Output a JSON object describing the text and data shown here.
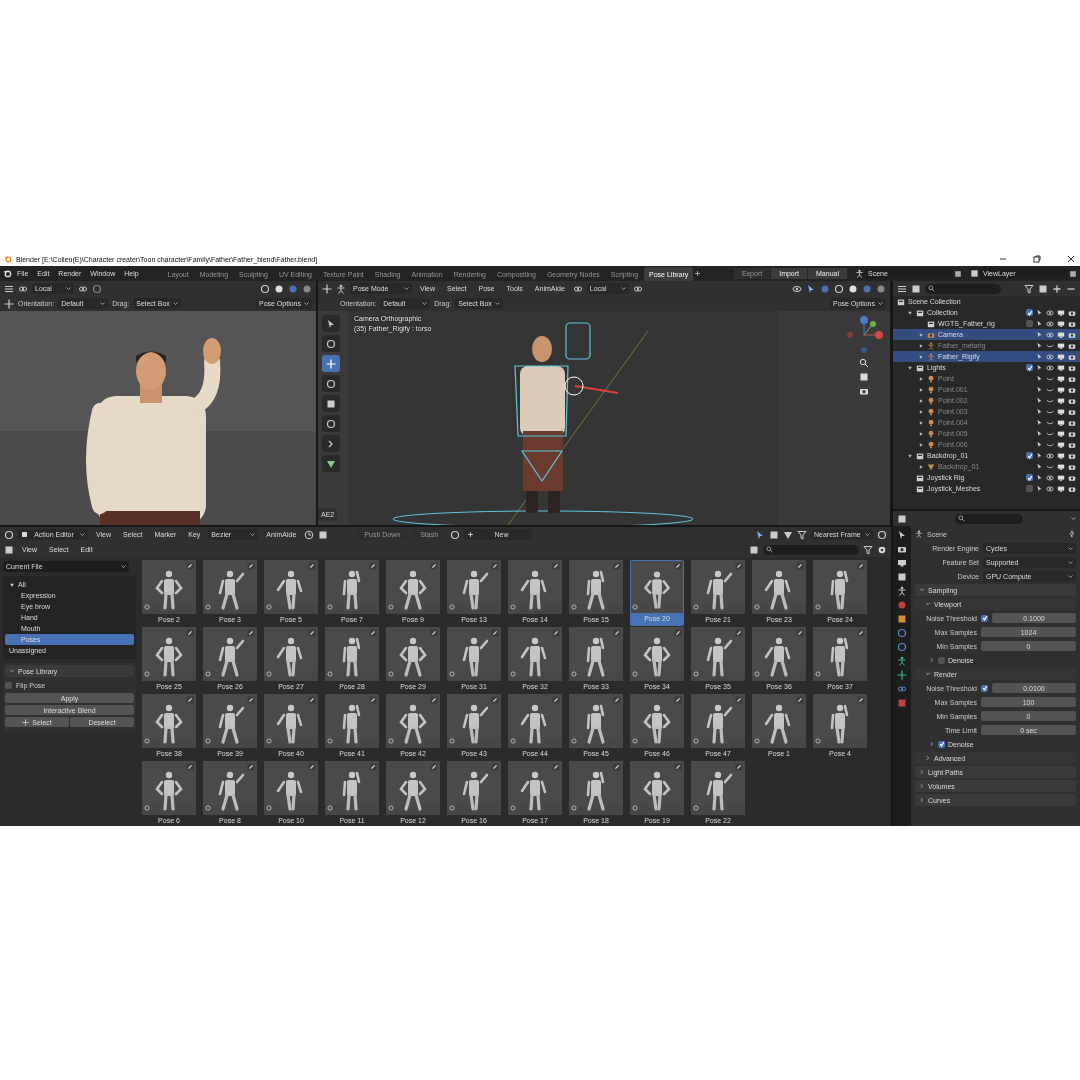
{
  "title_bar": {
    "title": "Blender [E:\\Collen(E)\\Character creater\\Toon character\\Family\\Father\\Father_blend\\Father.blend]"
  },
  "menu_bar": {
    "menus": [
      "File",
      "Edit",
      "Render",
      "Window",
      "Help"
    ],
    "workspaces": [
      {
        "label": "Layout",
        "selected": false
      },
      {
        "label": "Modeling",
        "selected": false
      },
      {
        "label": "Sculpting",
        "selected": false
      },
      {
        "label": "UV Editing",
        "selected": false
      },
      {
        "label": "Texture Paint",
        "selected": false
      },
      {
        "label": "Shading",
        "selected": false
      },
      {
        "label": "Animation",
        "selected": false
      },
      {
        "label": "Rendering",
        "selected": false
      },
      {
        "label": "Compositing",
        "selected": false
      },
      {
        "label": "Geometry Nodes",
        "selected": false
      },
      {
        "label": "Scripting",
        "selected": false
      },
      {
        "label": "Pose Library",
        "selected": true
      }
    ],
    "actions": [
      {
        "label": "Export",
        "disabled": true
      },
      {
        "label": "Import",
        "disabled": false
      },
      {
        "label": "Manual",
        "disabled": false
      }
    ],
    "scene": "Scene",
    "view_layer": "ViewLayer"
  },
  "left_viewport": {
    "pivot": "Local",
    "orientation_label": "Orientation:",
    "orientation": "Default",
    "drag_label": "Drag:",
    "drag": "Select Box",
    "options": "Pose Options"
  },
  "main_viewport": {
    "mode": "Pose Mode",
    "menus": [
      "View",
      "Select",
      "Pose",
      "Tools",
      "AnimAide"
    ],
    "pivot": "Local",
    "orientation_label": "Orientation:",
    "orientation": "Default",
    "drag_label": "Drag:",
    "drag": "Select Box",
    "options": "Pose Options",
    "view_name": "Camera Orthographic",
    "object_info": "(35) Father_Rigify : torso",
    "side_tab": "AE2"
  },
  "outliner": {
    "root": "Scene Collection",
    "items": [
      {
        "name": "Collection",
        "kind": "collection",
        "expanded": true,
        "selected": false,
        "checked": true,
        "children": [
          {
            "name": "WGTS_Father_rig",
            "kind": "collection",
            "selected": false,
            "checked": false
          },
          {
            "name": "Camera",
            "kind": "camera",
            "expanded": false,
            "selected": true,
            "hidden": false
          },
          {
            "name": "Father_metarig",
            "kind": "armature",
            "expanded": false,
            "selected": false,
            "hidden": true
          },
          {
            "name": "Father_Rigify",
            "kind": "armature",
            "expanded": false,
            "selected": true,
            "hidden": false
          }
        ]
      },
      {
        "name": "Lights",
        "kind": "collection",
        "expanded": true,
        "selected": false,
        "checked": true,
        "children": [
          {
            "name": "Point",
            "kind": "light",
            "expanded": false,
            "selected": false,
            "hidden": true
          },
          {
            "name": "Point.001",
            "kind": "light",
            "expanded": false,
            "selected": false,
            "hidden": true
          },
          {
            "name": "Point.002",
            "kind": "light",
            "expanded": false,
            "selected": false,
            "hidden": true
          },
          {
            "name": "Point.003",
            "kind": "light",
            "expanded": false,
            "selected": false,
            "hidden": true
          },
          {
            "name": "Point.004",
            "kind": "light",
            "expanded": false,
            "selected": false,
            "hidden": true
          },
          {
            "name": "Point.005",
            "kind": "light",
            "expanded": false,
            "selected": false,
            "hidden": true
          },
          {
            "name": "Point.006",
            "kind": "light",
            "expanded": false,
            "selected": false,
            "hidden": true
          }
        ]
      },
      {
        "name": "Backdrop_01",
        "kind": "collection",
        "expanded": true,
        "selected": false,
        "checked": true,
        "children": [
          {
            "name": "Backdrop_01",
            "kind": "mesh",
            "expanded": false,
            "selected": false,
            "hidden": true
          }
        ]
      },
      {
        "name": "Joystick Rig",
        "kind": "collection",
        "selected": false,
        "checked": true
      },
      {
        "name": "Joystick_Meshes",
        "kind": "collection",
        "selected": false,
        "checked": false
      }
    ]
  },
  "properties": {
    "context": "Scene",
    "fields": [
      {
        "label": "Render Engine",
        "value": "Cycles"
      },
      {
        "label": "Feature Set",
        "value": "Supported"
      },
      {
        "label": "Device",
        "value": "GPU Compute"
      }
    ],
    "panels": [
      {
        "title": "Sampling",
        "expanded": true,
        "subpanels": [
          {
            "title": "Viewport",
            "expanded": true,
            "rows": [
              {
                "kind": "check_number",
                "label": "Noise Threshold",
                "checked": true,
                "value": "0.1000"
              },
              {
                "kind": "number",
                "label": "Max Samples",
                "value": "1024"
              },
              {
                "kind": "number",
                "label": "Min Samples",
                "value": "0"
              }
            ],
            "sub": {
              "title": "Denoise",
              "checked": false,
              "expanded": false
            }
          },
          {
            "title": "Render",
            "expanded": true,
            "rows": [
              {
                "kind": "check_number",
                "label": "Noise Threshold",
                "checked": true,
                "value": "0.0100"
              },
              {
                "kind": "number",
                "label": "Max Samples",
                "value": "100"
              },
              {
                "kind": "number",
                "label": "Min Samples",
                "value": "0"
              },
              {
                "kind": "number",
                "label": "Time Limit",
                "value": "0 sec"
              }
            ],
            "sub": {
              "title": "Denoise",
              "checked": true,
              "expanded": false
            }
          },
          {
            "title": "Advanced",
            "expanded": false
          }
        ]
      },
      {
        "title": "Light Paths",
        "expanded": false
      },
      {
        "title": "Volumes",
        "expanded": false
      },
      {
        "title": "Curves",
        "expanded": false
      }
    ]
  },
  "action_editor": {
    "editor": "Action Editor",
    "menus": [
      "View",
      "Select",
      "Marker",
      "Key"
    ],
    "interpolation": "Bezier",
    "addon": "AnimAide",
    "buttons": [
      {
        "label": "Push Down",
        "disabled": true
      },
      {
        "label": "Stash",
        "disabled": true
      }
    ],
    "new": "New",
    "snap": "Nearest Frame"
  },
  "asset_browser": {
    "menus": [
      "View",
      "Select",
      "Edit"
    ],
    "library": "Current File",
    "catalogs": [
      {
        "label": "All",
        "expanded": true,
        "selected": false,
        "children": [
          {
            "label": "Expression",
            "selected": false
          },
          {
            "label": "Eye brow",
            "selected": false
          },
          {
            "label": "Hand",
            "selected": false
          },
          {
            "label": "Mouth",
            "selected": false
          },
          {
            "label": "Poses",
            "selected": true
          }
        ]
      },
      {
        "label": "Unassigned",
        "selected": false
      }
    ],
    "pose_library": {
      "title": "Pose Library",
      "expanded": true,
      "flip_pose": {
        "label": "Flip Pose",
        "checked": false
      },
      "buttons": [
        "Apply",
        "Interactive Blend"
      ],
      "select": "Select",
      "deselect": "Deselect"
    },
    "poses": [
      {
        "label": "Pose 2",
        "selected": false
      },
      {
        "label": "Pose 3",
        "selected": false
      },
      {
        "label": "Pose 5",
        "selected": false
      },
      {
        "label": "Pose 7",
        "selected": false
      },
      {
        "label": "Pose 9",
        "selected": false
      },
      {
        "label": "Pose 13",
        "selected": false
      },
      {
        "label": "Pose 14",
        "selected": false
      },
      {
        "label": "Pose 15",
        "selected": false
      },
      {
        "label": "Pose 20",
        "selected": true
      },
      {
        "label": "Pose 21",
        "selected": false
      },
      {
        "label": "Pose 23",
        "selected": false
      },
      {
        "label": "Pose 24",
        "selected": false
      },
      {
        "label": "Pose 25",
        "selected": false
      },
      {
        "label": "Pose 26",
        "selected": false
      },
      {
        "label": "Pose 27",
        "selected": false
      },
      {
        "label": "Pose 28",
        "selected": false
      },
      {
        "label": "Pose 29",
        "selected": false
      },
      {
        "label": "Pose 31",
        "selected": false
      },
      {
        "label": "Pose 32",
        "selected": false
      },
      {
        "label": "Pose 33",
        "selected": false
      },
      {
        "label": "Pose 34",
        "selected": false
      },
      {
        "label": "Pose 35",
        "selected": false
      },
      {
        "label": "Pose 36",
        "selected": false
      },
      {
        "label": "Pose 37",
        "selected": false
      },
      {
        "label": "Pose 38",
        "selected": false
      },
      {
        "label": "Pose 39",
        "selected": false
      },
      {
        "label": "Pose 40",
        "selected": false
      },
      {
        "label": "Pose 41",
        "selected": false
      },
      {
        "label": "Pose 42",
        "selected": false
      },
      {
        "label": "Pose 43",
        "selected": false
      },
      {
        "label": "Pose 44",
        "selected": false
      },
      {
        "label": "Pose 45",
        "selected": false
      },
      {
        "label": "Pose 46",
        "selected": false
      },
      {
        "label": "Pose 47",
        "selected": false
      },
      {
        "label": "Pose 1",
        "selected": false
      },
      {
        "label": "Pose 4",
        "selected": false
      },
      {
        "label": "Pose 6",
        "selected": false
      },
      {
        "label": "Pose 8",
        "selected": false
      },
      {
        "label": "Pose 10",
        "selected": false
      },
      {
        "label": "Pose 11",
        "selected": false
      },
      {
        "label": "Pose 12",
        "selected": false
      },
      {
        "label": "Pose 16",
        "selected": false
      },
      {
        "label": "Pose 17",
        "selected": false
      },
      {
        "label": "Pose 18",
        "selected": false
      },
      {
        "label": "Pose 19",
        "selected": false
      },
      {
        "label": "Pose 22",
        "selected": false
      }
    ]
  }
}
